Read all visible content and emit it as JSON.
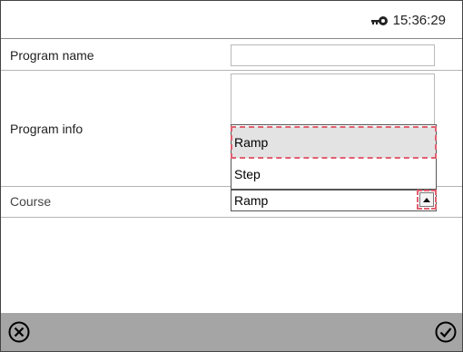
{
  "header": {
    "time": "15:36:29",
    "icon": "key-icon"
  },
  "form": {
    "program_name": {
      "label": "Program name",
      "value": ""
    },
    "program_info": {
      "label": "Program info",
      "value": ""
    },
    "course": {
      "label": "Course",
      "selected": "Ramp",
      "options": [
        "Ramp",
        "Step"
      ]
    }
  },
  "footer": {
    "cancel_icon": "cancel-icon",
    "confirm_icon": "check-icon"
  },
  "colors": {
    "footer_bg": "#a5a5a5",
    "highlight_border": "#e06070",
    "selected_bg": "#e3e3e3"
  }
}
